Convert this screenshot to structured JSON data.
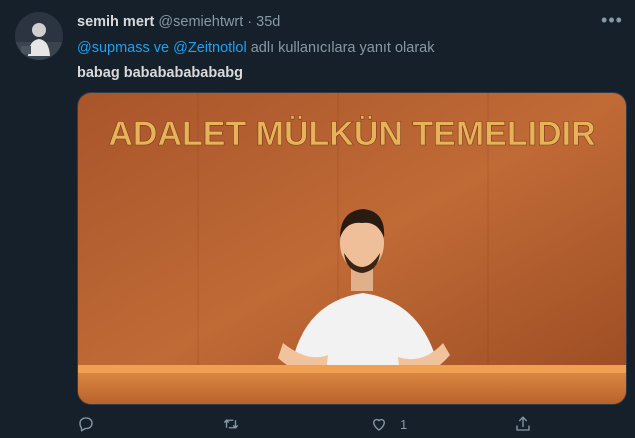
{
  "tweet": {
    "author_name": "semih mert",
    "handle": "@semiehtwrt",
    "dot": "·",
    "time": "35d",
    "reply_mention_1": "@supmass",
    "reply_sep": " ve ",
    "reply_mention_2": "@Zeitnotlol",
    "reply_suffix": " adlı kullanıcılara yanıt olarak",
    "text": "babag bababababababg",
    "media": {
      "wall_text": "ADALET MÜLKÜN TEMELIDIR"
    },
    "actions": {
      "reply_icon": "reply-icon",
      "retweet_icon": "retweet-icon",
      "like_icon": "heart-icon",
      "like_count": "1",
      "share_icon": "share-icon"
    }
  },
  "colors": {
    "background": "#15202b",
    "text": "#d9d9d9",
    "muted": "#8899a6",
    "accent": "#1da1f2"
  }
}
